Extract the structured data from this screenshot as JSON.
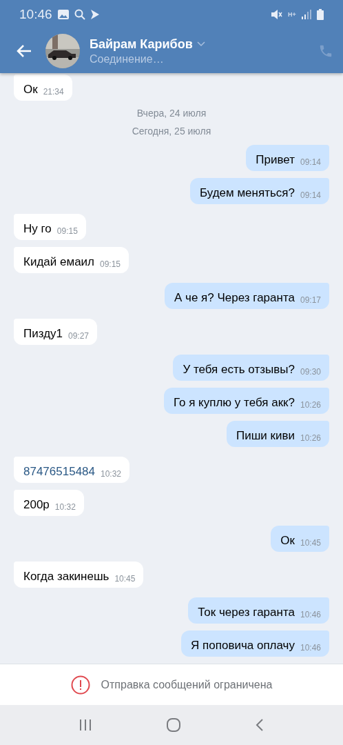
{
  "status_bar": {
    "time": "10:46",
    "network": "H+"
  },
  "header": {
    "name": "Байрам Карибов",
    "status": "Соединение…"
  },
  "chat": [
    {
      "kind": "message",
      "outgoing": false,
      "text": "Ок",
      "time": "21:34"
    },
    {
      "kind": "date",
      "text": "Вчера, 24 июля"
    },
    {
      "kind": "date",
      "text": "Сегодня, 25 июля"
    },
    {
      "kind": "message",
      "outgoing": true,
      "text": "Привет",
      "time": "09:14"
    },
    {
      "kind": "message",
      "outgoing": true,
      "text": "Будем меняться?",
      "time": "09:14"
    },
    {
      "kind": "message",
      "outgoing": false,
      "text": "Ну го",
      "time": "09:15"
    },
    {
      "kind": "message",
      "outgoing": false,
      "text": "Кидай емаил",
      "time": "09:15"
    },
    {
      "kind": "message",
      "outgoing": true,
      "text": "А че я? Через гаранта",
      "time": "09:17"
    },
    {
      "kind": "message",
      "outgoing": false,
      "text": "Пизду1",
      "time": "09:27"
    },
    {
      "kind": "message",
      "outgoing": true,
      "text": "У тебя есть отзывы?",
      "time": "09:30"
    },
    {
      "kind": "message",
      "outgoing": true,
      "text": "Го я куплю у тебя акк?",
      "time": "10:26"
    },
    {
      "kind": "message",
      "outgoing": true,
      "text": "Пиши киви",
      "time": "10:26"
    },
    {
      "kind": "link",
      "outgoing": false,
      "text": "87476515484",
      "time": "10:32"
    },
    {
      "kind": "message",
      "outgoing": false,
      "text": "200р",
      "time": "10:32"
    },
    {
      "kind": "message",
      "outgoing": true,
      "text": "Ок",
      "time": "10:45"
    },
    {
      "kind": "message",
      "outgoing": false,
      "text": "Когда закинешь",
      "time": "10:45"
    },
    {
      "kind": "message",
      "outgoing": true,
      "text": "Ток через гаранта",
      "time": "10:46"
    },
    {
      "kind": "message",
      "outgoing": true,
      "text": "Я поповича оплачу",
      "time": "10:46"
    }
  ],
  "notice": {
    "text": "Отправка сообщений ограничена"
  }
}
